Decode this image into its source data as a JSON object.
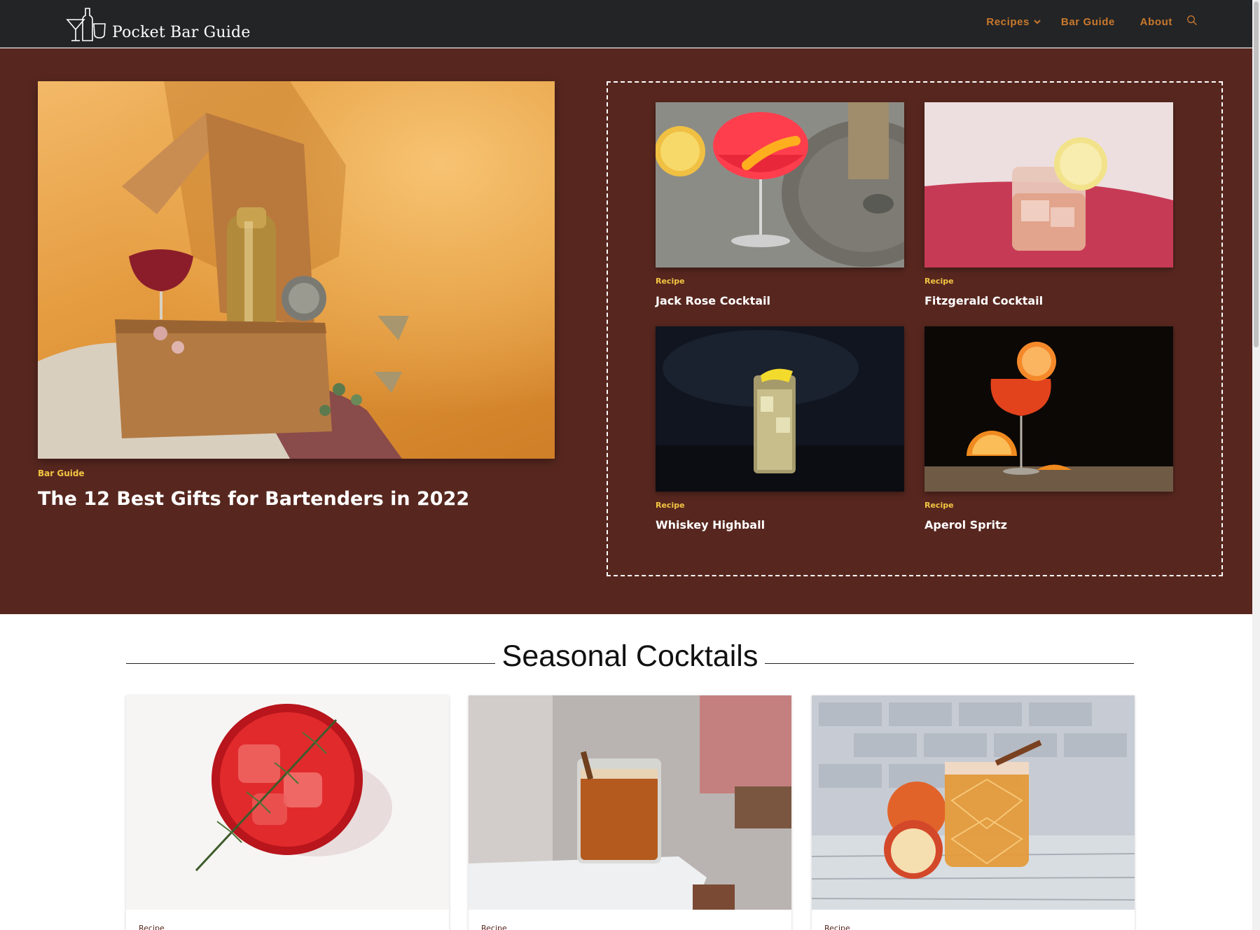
{
  "site": {
    "logo_text": "Pocket Bar Guide",
    "logo_icon": "bottle-glass-logo"
  },
  "nav": {
    "items": [
      {
        "label": "Recipes",
        "has_dropdown": true
      },
      {
        "label": "Bar Guide"
      },
      {
        "label": "About"
      }
    ],
    "search_icon": "search-icon",
    "accent_color": "#c9792d"
  },
  "hero": {
    "background_color": "#57271f",
    "featured": {
      "category": "Bar Guide",
      "title": "The 12 Best Gifts for Bartenders in 2022"
    },
    "grid": [
      {
        "category": "Recipe",
        "title": "Jack Rose Cocktail"
      },
      {
        "category": "Recipe",
        "title": "Fitzgerald Cocktail"
      },
      {
        "category": "Recipe",
        "title": "Whiskey Highball"
      },
      {
        "category": "Recipe",
        "title": "Aperol Spritz"
      }
    ]
  },
  "seasonal": {
    "heading": "Seasonal Cocktails",
    "cards": [
      {
        "category": "Recipe"
      },
      {
        "category": "Recipe"
      },
      {
        "category": "Recipe"
      }
    ]
  }
}
